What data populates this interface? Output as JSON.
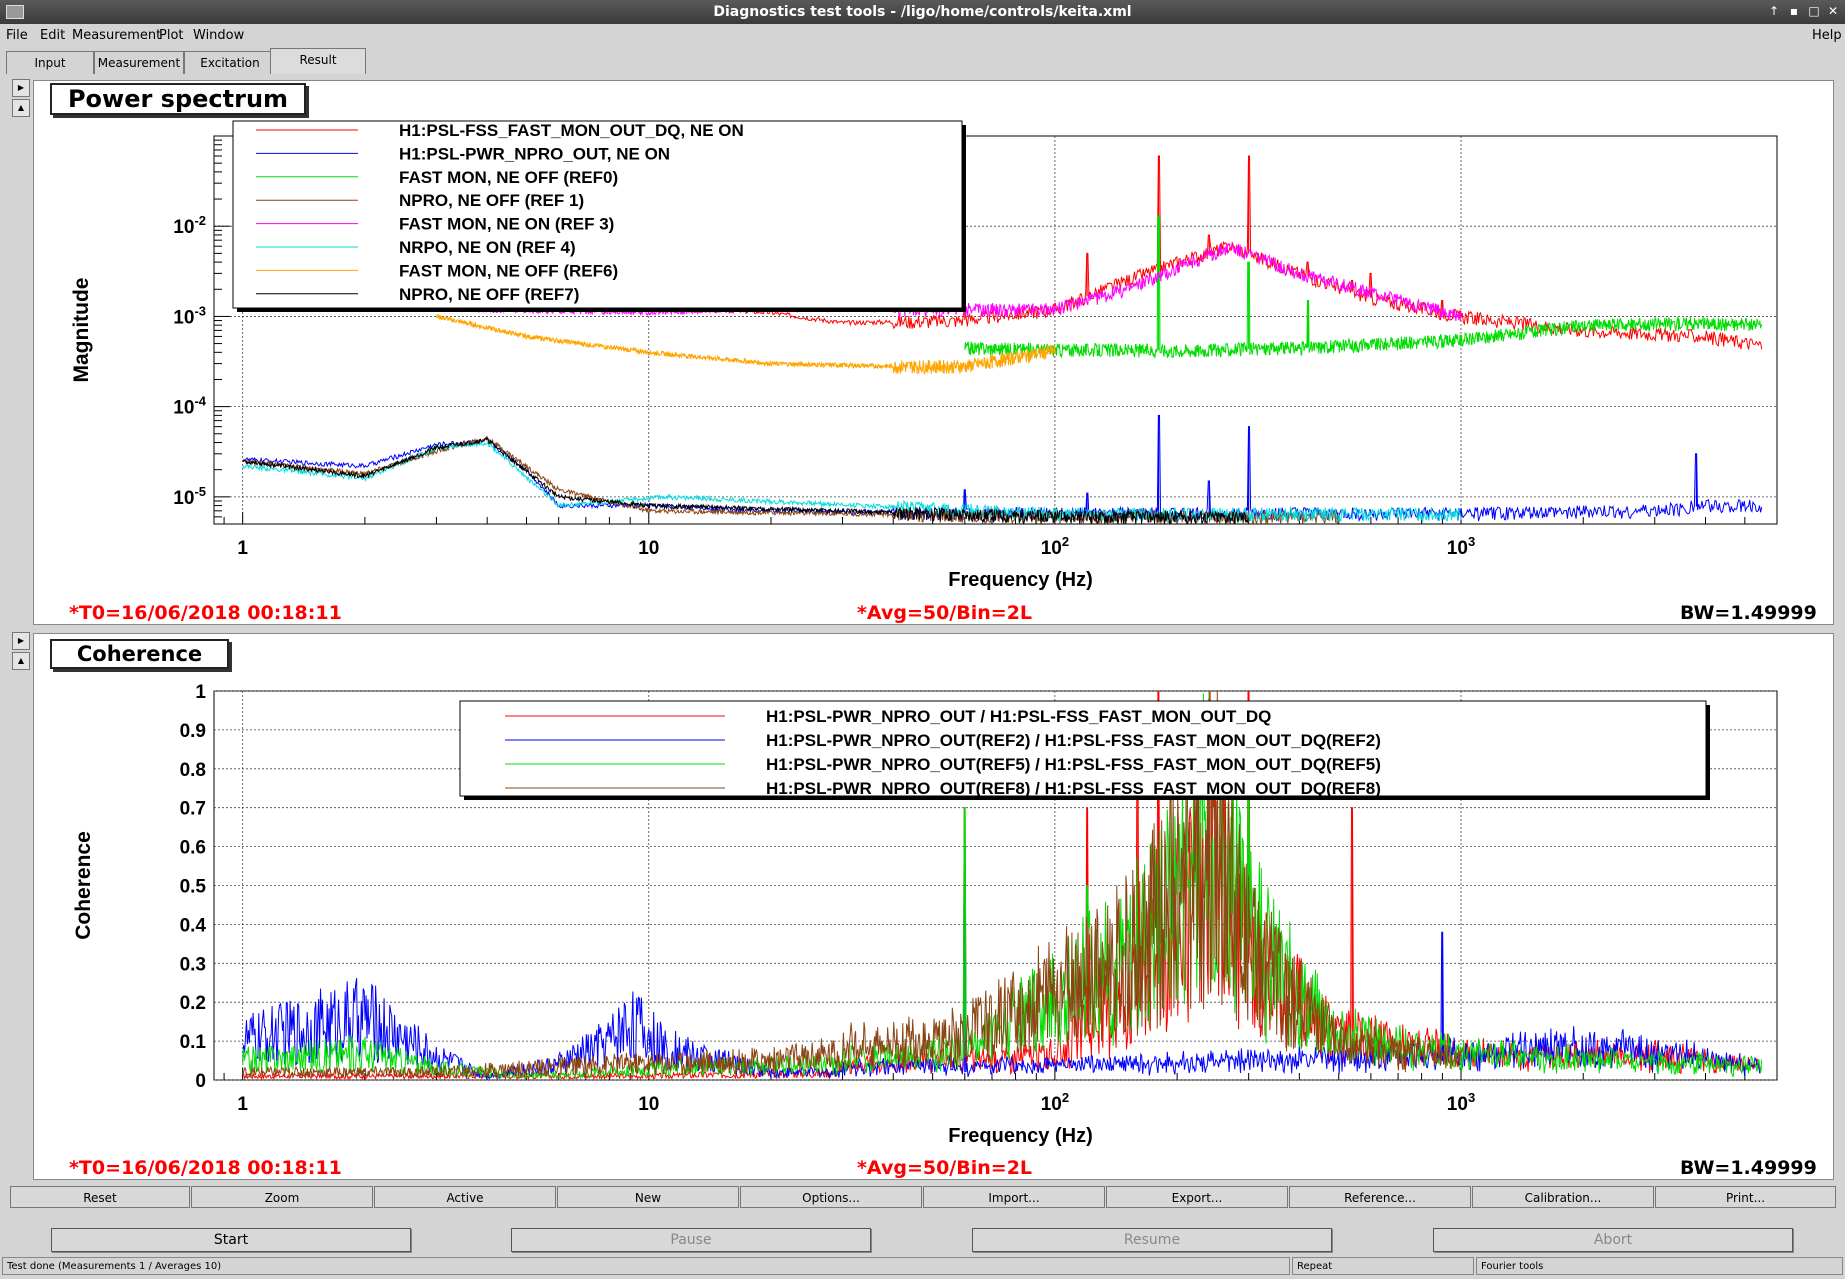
{
  "window": {
    "title": "Diagnostics test tools - /ligo/home/controls/keita.xml",
    "help": "Help"
  },
  "menu": [
    "File",
    "Edit",
    "Measurement",
    "Plot",
    "Window"
  ],
  "tabs": [
    "Input",
    "Measurement",
    "Excitation",
    "Result"
  ],
  "colors": {
    "red": "#ff0000",
    "blue": "#0000ff",
    "green": "#00dd00",
    "brown": "#8b4513",
    "magenta": "#ff00ff",
    "cyan": "#00dddd",
    "orange": "#ffa500",
    "black": "#000000",
    "info": "#ff0000"
  },
  "power": {
    "title": "Power spectrum",
    "info_t0": "*T0=16/06/2018 00:18:11",
    "info_avg": "*Avg=50/Bin=2L",
    "info_bw": "BW=1.49999",
    "legend": [
      "H1:PSL-FSS_FAST_MON_OUT_DQ, NE ON",
      "H1:PSL-PWR_NPRO_OUT, NE ON",
      "FAST MON, NE OFF (REF0)",
      "NPRO, NE OFF (REF 1)",
      "FAST MON, NE ON (REF 3)",
      "NRPO, NE ON (REF 4)",
      "FAST MON, NE OFF (REF6)",
      "NPRO, NE OFF (REF7)"
    ]
  },
  "coherence": {
    "title": "Coherence",
    "info_t0": "*T0=16/06/2018 00:18:11",
    "info_avg": "*Avg=50/Bin=2L",
    "info_bw": "BW=1.49999",
    "legend": [
      "H1:PSL-PWR_NPRO_OUT / H1:PSL-FSS_FAST_MON_OUT_DQ",
      "H1:PSL-PWR_NPRO_OUT(REF2) / H1:PSL-FSS_FAST_MON_OUT_DQ(REF2)",
      "H1:PSL-PWR_NPRO_OUT(REF5) / H1:PSL-FSS_FAST_MON_OUT_DQ(REF5)",
      "H1:PSL-PWR_NPRO_OUT(REF8) / H1:PSL-FSS_FAST_MON_OUT_DQ(REF8)"
    ]
  },
  "chart_data": [
    {
      "type": "line",
      "title": "Power spectrum",
      "xlabel": "Frequency (Hz)",
      "ylabel": "Magnitude",
      "xscale": "log",
      "yscale": "log",
      "xlim": [
        0.85,
        6000
      ],
      "ylim": [
        5e-06,
        0.1
      ],
      "xticks": [
        "1",
        "10",
        "10^2",
        "10^3"
      ],
      "yticks": [
        "10^-5",
        "10^-4",
        "10^-3",
        "10^-2"
      ],
      "grid": true,
      "legend_position": "top-left",
      "series": [
        {
          "name": "H1:PSL-FSS_FAST_MON_OUT_DQ, NE ON",
          "color": "red",
          "points": [
            [
              1,
              0.003
            ],
            [
              3,
              0.0016
            ],
            [
              10,
              0.0013
            ],
            [
              20,
              0.0011
            ],
            [
              30,
              0.00085
            ],
            [
              58,
              0.0009
            ],
            [
              100,
              0.0012
            ],
            [
              150,
              0.0025
            ],
            [
              200,
              0.004
            ],
            [
              270,
              0.006
            ],
            [
              400,
              0.003
            ],
            [
              600,
              0.0016
            ],
            [
              1000,
              0.001
            ],
            [
              2000,
              0.0007
            ],
            [
              4000,
              0.0006
            ],
            [
              5500,
              0.00048
            ]
          ],
          "peaks": [
            [
              60,
              0.0012
            ],
            [
              120,
              0.005
            ],
            [
              180,
              0.06
            ],
            [
              240,
              0.008
            ],
            [
              300,
              0.06
            ],
            [
              420,
              0.004
            ],
            [
              540,
              0.0025
            ],
            [
              600,
              0.003
            ],
            [
              900,
              0.0015
            ]
          ]
        },
        {
          "name": "H1:PSL-PWR_NPRO_OUT, NE ON",
          "color": "blue",
          "points": [
            [
              1,
              2.6e-05
            ],
            [
              2,
              2.2e-05
            ],
            [
              3,
              3.8e-05
            ],
            [
              4,
              4.2e-05
            ],
            [
              5,
              2e-05
            ],
            [
              6,
              8e-06
            ],
            [
              10,
              8e-06
            ],
            [
              20,
              7e-06
            ],
            [
              100,
              6.5e-06
            ],
            [
              1000,
              6.5e-06
            ],
            [
              3000,
              7e-06
            ],
            [
              4000,
              8e-06
            ],
            [
              5500,
              8e-06
            ]
          ],
          "peaks": [
            [
              60,
              1.2e-05
            ],
            [
              120,
              1.1e-05
            ],
            [
              180,
              8e-05
            ],
            [
              240,
              1.5e-05
            ],
            [
              300,
              6e-05
            ],
            [
              3800,
              3e-05
            ]
          ]
        },
        {
          "name": "FAST MON, NE OFF (REF0)",
          "color": "green",
          "points": [
            [
              60,
              0.00045
            ],
            [
              100,
              0.00043
            ],
            [
              200,
              0.00042
            ],
            [
              400,
              0.00045
            ],
            [
              1000,
              0.00055
            ],
            [
              2000,
              0.0008
            ],
            [
              4000,
              0.00085
            ],
            [
              5500,
              0.0008
            ]
          ],
          "peaks": [
            [
              180,
              0.013
            ],
            [
              300,
              0.004
            ],
            [
              420,
              0.0015
            ]
          ]
        },
        {
          "name": "NPRO, NE OFF (REF 1)",
          "color": "brown",
          "points": [
            [
              1,
              2.5e-05
            ],
            [
              2,
              1.8e-05
            ],
            [
              3,
              3.2e-05
            ],
            [
              4,
              4.5e-05
            ],
            [
              6,
              1.2e-05
            ],
            [
              10,
              7e-06
            ],
            [
              100,
              6e-06
            ],
            [
              500,
              6e-06
            ]
          ]
        },
        {
          "name": "FAST MON, NE ON (REF 3)",
          "color": "magenta",
          "points": [
            [
              3,
              0.0012
            ],
            [
              10,
              0.0011
            ],
            [
              20,
              0.0012
            ],
            [
              40,
              0.0012
            ],
            [
              100,
              0.0012
            ],
            [
              150,
              0.002
            ],
            [
              270,
              0.006
            ],
            [
              400,
              0.003
            ],
            [
              1000,
              0.001
            ]
          ]
        },
        {
          "name": "NRPO, NE ON (REF 4)",
          "color": "cyan",
          "points": [
            [
              1,
              2.2e-05
            ],
            [
              2,
              1.6e-05
            ],
            [
              3,
              3.5e-05
            ],
            [
              4,
              4e-05
            ],
            [
              6,
              8e-06
            ],
            [
              11,
              1e-05
            ],
            [
              100,
              6.5e-06
            ],
            [
              1000,
              6.5e-06
            ]
          ]
        },
        {
          "name": "FAST MON, NE OFF (REF6)",
          "color": "orange",
          "points": [
            [
              3,
              0.001
            ],
            [
              5,
              0.0006
            ],
            [
              10,
              0.0004
            ],
            [
              20,
              0.0003
            ],
            [
              40,
              0.00028
            ],
            [
              60,
              0.00028
            ],
            [
              100,
              0.00042
            ]
          ]
        },
        {
          "name": "NPRO, NE OFF (REF7)",
          "color": "black",
          "points": [
            [
              1,
              2.5e-05
            ],
            [
              2,
              1.7e-05
            ],
            [
              3,
              3.5e-05
            ],
            [
              4,
              4.3e-05
            ],
            [
              6,
              1e-05
            ],
            [
              10,
              8e-06
            ],
            [
              100,
              6e-06
            ],
            [
              300,
              6e-06
            ]
          ]
        }
      ]
    },
    {
      "type": "line",
      "title": "Coherence",
      "xlabel": "Frequency (Hz)",
      "ylabel": "Coherence",
      "xscale": "log",
      "yscale": "linear",
      "xlim": [
        0.85,
        6000
      ],
      "ylim": [
        0,
        1
      ],
      "xticks": [
        "1",
        "10",
        "10^2",
        "10^3"
      ],
      "yticks": [
        "0",
        "0.1",
        "0.2",
        "0.3",
        "0.4",
        "0.5",
        "0.6",
        "0.7",
        "0.8",
        "0.9",
        "1"
      ],
      "grid": true,
      "legend_position": "top-right",
      "series": [
        {
          "name": "H1:PSL-PWR_NPRO_OUT / H1:PSL-FSS_FAST_MON_OUT_DQ",
          "color": "red",
          "points": [
            [
              1,
              0.01
            ],
            [
              10,
              0.01
            ],
            [
              30,
              0.02
            ],
            [
              100,
              0.05
            ],
            [
              150,
              0.2
            ],
            [
              250,
              0.5
            ],
            [
              300,
              0.3
            ],
            [
              500,
              0.1
            ],
            [
              1000,
              0.05
            ],
            [
              3000,
              0.05
            ],
            [
              5500,
              0.02
            ]
          ],
          "peaks": [
            [
              60,
              0.7
            ],
            [
              120,
              0.7
            ],
            [
              160,
              0.9
            ],
            [
              180,
              1
            ],
            [
              240,
              1
            ],
            [
              300,
              1
            ],
            [
              540,
              0.7
            ]
          ]
        },
        {
          "name": "H1:PSL-PWR_NPRO_OUT(REF2) / H1:PSL-FSS_FAST_MON_OUT_DQ(REF2)",
          "color": "blue",
          "points": [
            [
              1,
              0.1
            ],
            [
              2,
              0.16
            ],
            [
              3,
              0.06
            ],
            [
              4,
              0.01
            ],
            [
              6,
              0.04
            ],
            [
              8,
              0.1
            ],
            [
              9,
              0.15
            ],
            [
              11,
              0.08
            ],
            [
              20,
              0.02
            ],
            [
              100,
              0.02
            ],
            [
              1000,
              0.05
            ],
            [
              2000,
              0.07
            ],
            [
              4000,
              0.04
            ],
            [
              5500,
              0.02
            ]
          ],
          "peaks": [
            [
              60,
              0.6
            ],
            [
              900,
              0.38
            ]
          ]
        },
        {
          "name": "H1:PSL-PWR_NPRO_OUT(REF5) / H1:PSL-FSS_FAST_MON_OUT_DQ(REF5)",
          "color": "green",
          "points": [
            [
              1,
              0.05
            ],
            [
              2,
              0.07
            ],
            [
              3,
              0.03
            ],
            [
              5,
              0.01
            ],
            [
              10,
              0.03
            ],
            [
              30,
              0.04
            ],
            [
              60,
              0.06
            ],
            [
              150,
              0.3
            ],
            [
              250,
              0.62
            ],
            [
              300,
              0.35
            ],
            [
              500,
              0.1
            ],
            [
              1000,
              0.05
            ],
            [
              5500,
              0.02
            ]
          ],
          "peaks": [
            [
              60,
              0.7
            ],
            [
              120,
              0.5
            ],
            [
              300,
              0.8
            ]
          ]
        },
        {
          "name": "H1:PSL-PWR_NPRO_OUT(REF8) / H1:PSL-FSS_FAST_MON_OUT_DQ(REF8)",
          "color": "brown",
          "points": [
            [
              1,
              0.02
            ],
            [
              3,
              0.02
            ],
            [
              8,
              0.04
            ],
            [
              20,
              0.05
            ],
            [
              60,
              0.1
            ],
            [
              150,
              0.3
            ],
            [
              250,
              0.6
            ],
            [
              300,
              0.3
            ],
            [
              500,
              0.08
            ],
            [
              1000,
              0.04
            ]
          ]
        }
      ]
    }
  ],
  "buttons": [
    "Reset",
    "Zoom",
    "Active",
    "New",
    "Options...",
    "Import...",
    "Export...",
    "Reference...",
    "Calibration...",
    "Print..."
  ],
  "controls": {
    "start": "Start",
    "pause": "Pause",
    "resume": "Resume",
    "abort": "Abort"
  },
  "status": {
    "main": "Test done (Measurements 1 / Averages 10)",
    "repeat": "Repeat",
    "tools": "Fourier tools"
  }
}
